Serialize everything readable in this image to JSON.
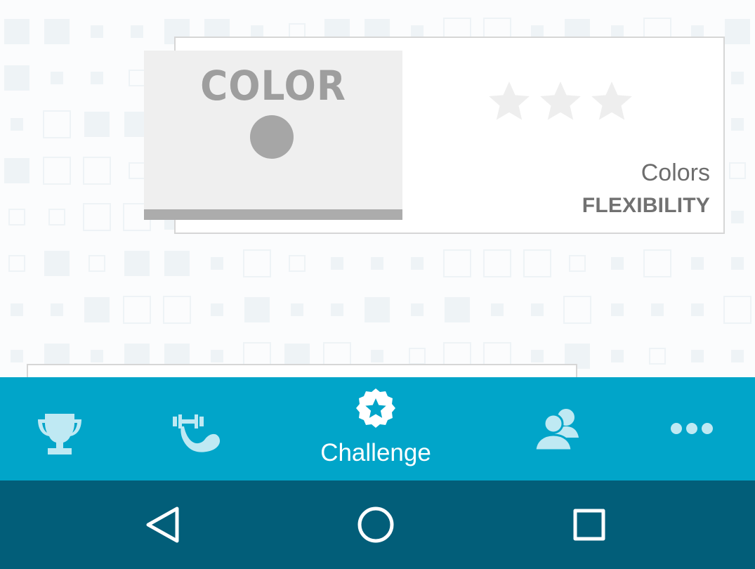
{
  "level_card": {
    "thumbnail_title": "COLOR",
    "stars_earned": 0,
    "stars_total": 3,
    "name": "Colors",
    "category": "FLEXIBILITY"
  },
  "tab_bar": {
    "tabs": [
      {
        "icon": "trophy-icon",
        "label": ""
      },
      {
        "icon": "flexed-arm-dumbbell-icon",
        "label": ""
      },
      {
        "icon": "star-badge-icon",
        "label": "Challenge"
      },
      {
        "icon": "people-icon",
        "label": ""
      },
      {
        "icon": "more-dots-icon",
        "label": ""
      }
    ],
    "active_tab": "Challenge"
  },
  "system_nav": {
    "buttons": [
      "back-icon",
      "home-icon",
      "recents-icon"
    ]
  },
  "colors": {
    "tab_bar": "#01a5c9",
    "tab_icon_inactive": "#bfe9f3",
    "system_nav": "#025e79",
    "star_empty": "#eeeeee",
    "thumbnail_gray": "#a6a6a6"
  }
}
